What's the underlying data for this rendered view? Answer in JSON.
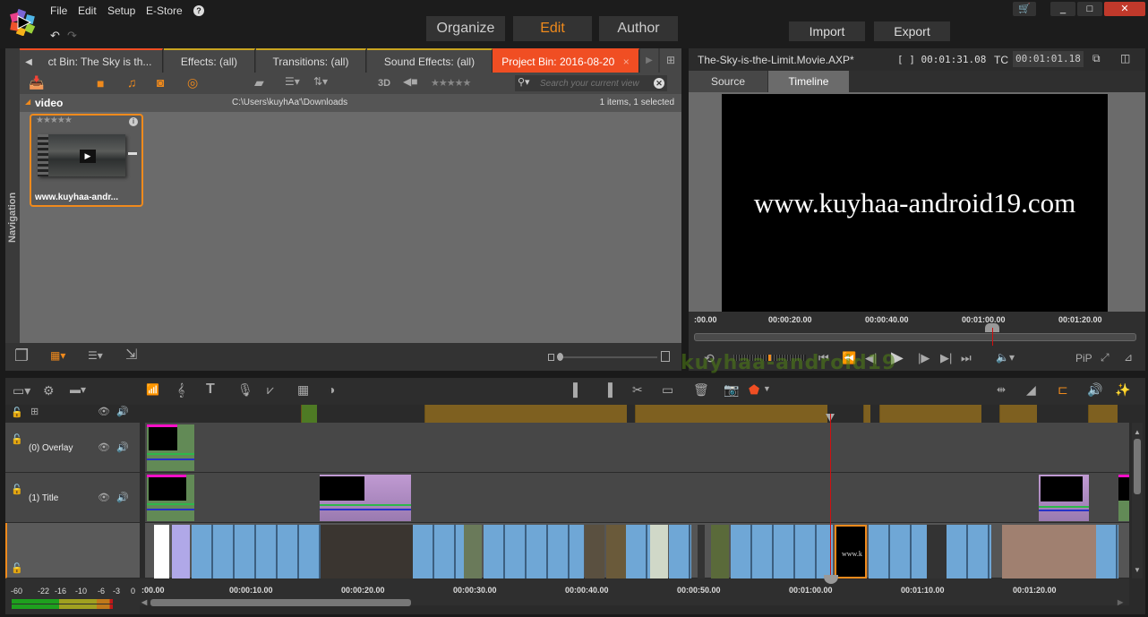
{
  "menu": {
    "items": [
      "File",
      "Edit",
      "Setup",
      "E-Store"
    ],
    "help_icon": "help-icon",
    "undo_icon": "undo-icon",
    "redo_icon": "redo-icon"
  },
  "modes": {
    "organize": "Organize",
    "edit": "Edit",
    "author": "Author",
    "active": "Edit"
  },
  "actions": {
    "import": "Import",
    "export": "Export"
  },
  "window": {
    "minimize": "_",
    "maximize": "□",
    "close": "✕"
  },
  "library": {
    "tabs": [
      {
        "label": "ct Bin: The Sky is th...",
        "active": false
      },
      {
        "label": "Effects: (all)",
        "active": false
      },
      {
        "label": "Transitions: (all)",
        "active": false
      },
      {
        "label": "Sound Effects: (all)",
        "active": false
      },
      {
        "label": "Project Bin: 2016-08-20",
        "active": true
      }
    ],
    "tab_close": "×",
    "nav_label": "Navigation",
    "view_3d": "3D",
    "search_placeholder": "Search your current view",
    "folder_name": "video",
    "folder_path": "C:\\Users\\kuyhAa'\\Downloads",
    "count_text": "1 items, 1 selected",
    "item": {
      "name": "www.kuyhaa-andr...",
      "rating": "★★★★★"
    }
  },
  "player": {
    "project_name": "The-Sky-is-the-Limit.Movie.AXP*",
    "duration": "[ ] 00:01:31.08",
    "tc_label": "TC",
    "timecode": "00:01:01.18",
    "tabs": {
      "source": "Source",
      "timeline": "Timeline",
      "active": "Timeline"
    },
    "video_text": "www.kuyhaa-android19.com",
    "ruler_labels": [
      ":00.00",
      "00:00:20.00",
      "00:00:40.00",
      "00:01:00.00",
      "00:01:20.00"
    ],
    "pip_label": "PiP"
  },
  "timeline": {
    "tracks": [
      {
        "name": "(0) Overlay"
      },
      {
        "name": "(1) Title"
      },
      {
        "name": ""
      }
    ],
    "ruler_labels": [
      ":00.00",
      "00:00:10.00",
      "00:00:20.00",
      "00:00:30.00",
      "00:00:40.00",
      "00:00:50.00",
      "00:01:00.00",
      "00:01:10.00",
      "00:01:20.00"
    ],
    "meter_labels": [
      "-60",
      "-22",
      "-16",
      "-10",
      "-6",
      "-3",
      "0"
    ],
    "clip_text": "www.k"
  },
  "watermark": "kuyhaa-android19",
  "colors": {
    "accent": "#f08a1c",
    "active_tab": "#f04e23",
    "playhead": "#d01010"
  }
}
